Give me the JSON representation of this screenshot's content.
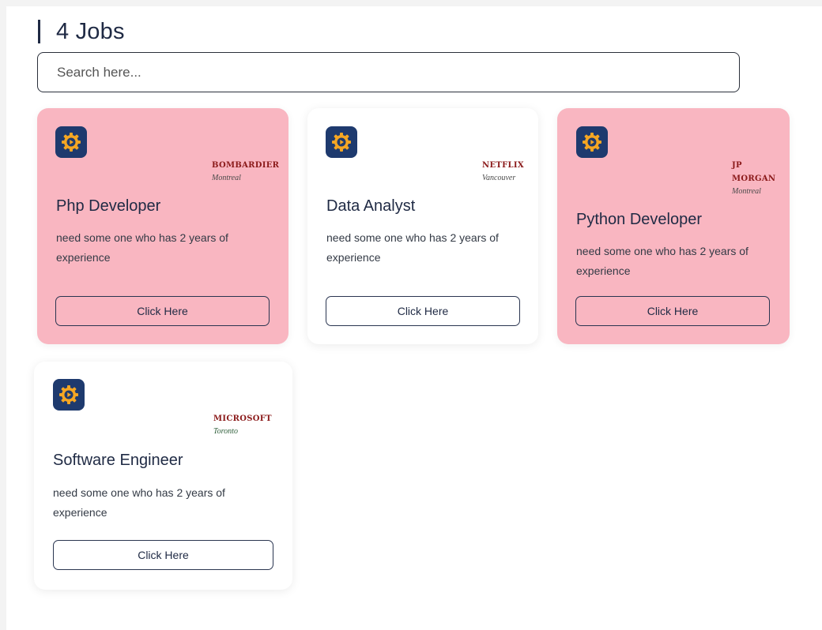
{
  "header": {
    "title": "4 Jobs"
  },
  "search": {
    "placeholder": "Search here..."
  },
  "colors": {
    "pink_card": "#f9b6c1",
    "icon_bg": "#1e3a6e",
    "icon_fg": "#f5a623",
    "company_red": "#8b1a1a",
    "company_green": "#2e5e3a"
  },
  "jobs": [
    {
      "company": "BOMBARDIER",
      "city": "Montreal",
      "title": "Php Developer",
      "description": "need some one who has 2 years of experience",
      "button": "Click Here",
      "icon": "gear-play-icon"
    },
    {
      "company": "NETFLIX",
      "city": "Vancouver",
      "title": "Data Analyst",
      "description": "need some one who has 2 years of experience",
      "button": "Click Here",
      "icon": "gear-play-icon"
    },
    {
      "company": "JP MORGAN",
      "city": "Montreal",
      "title": "Python Developer",
      "description": "need some one who has 2 years of experience",
      "button": "Click Here",
      "icon": "gear-play-icon"
    },
    {
      "company": "MICROSOFT",
      "city": "Toronto",
      "title": "Software Engineer",
      "description": "need some one who has 2 years of experience",
      "button": "Click Here",
      "icon": "gear-play-icon"
    }
  ]
}
